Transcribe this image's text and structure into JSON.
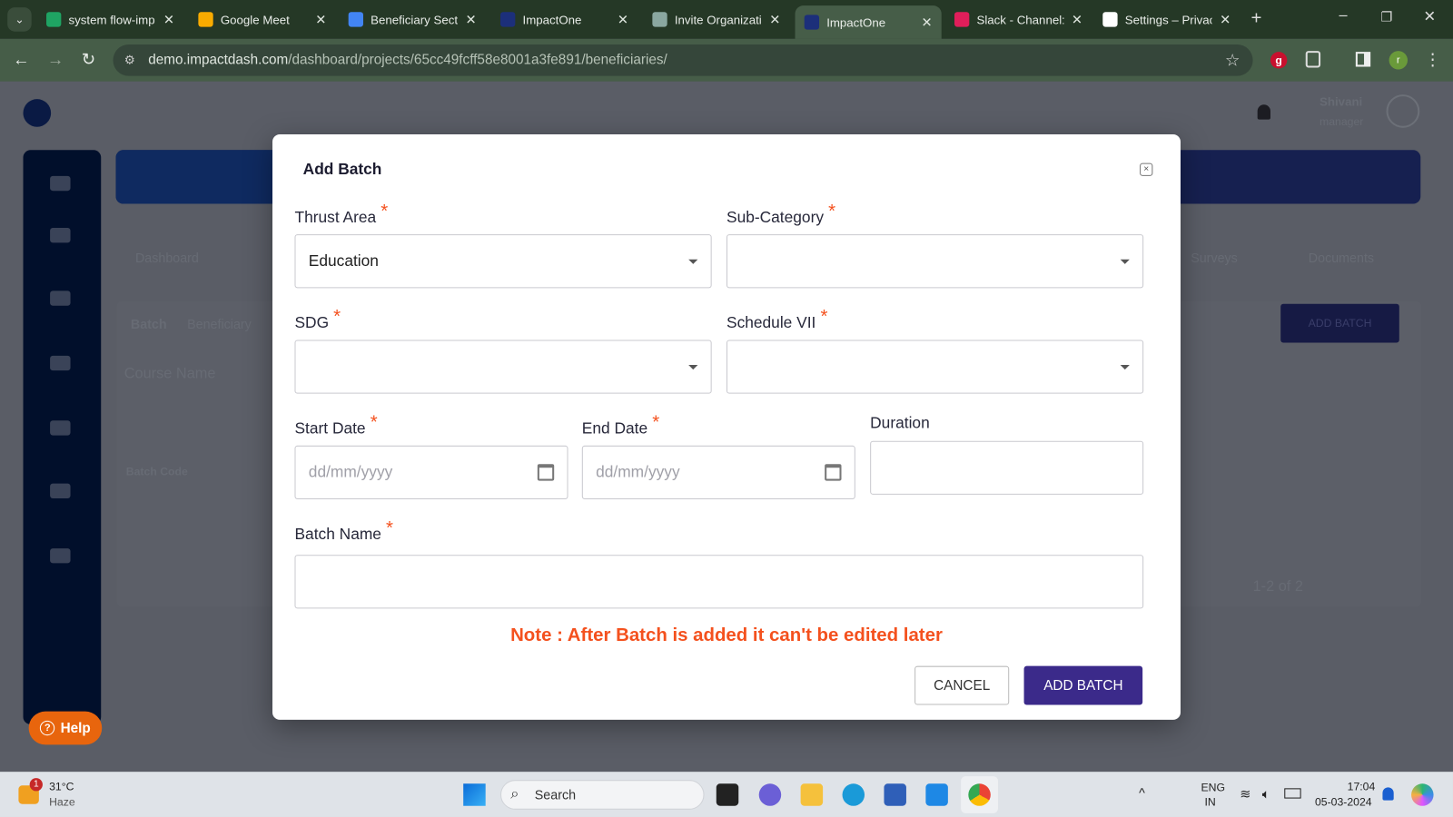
{
  "browser": {
    "tabs": [
      {
        "title": "system flow-imp",
        "color": "#1fa463"
      },
      {
        "title": "Google Meet",
        "color": "#f9ab00"
      },
      {
        "title": "Beneficiary Sectio",
        "color": "#4285f4"
      },
      {
        "title": "ImpactOne",
        "color": "#1c2f7a"
      },
      {
        "title": "Invite Organizatio",
        "color": "#8aa7a0"
      },
      {
        "title": "ImpactOne",
        "color": "#1c2f7a",
        "active": true
      },
      {
        "title": "Slack - Channel:",
        "color": "#e01e5a"
      },
      {
        "title": "Settings – Privacy",
        "color": "#ffffff"
      }
    ],
    "url_host": "demo.impactdash.com",
    "url_path": "/dashboard/projects/65cc49fcff58e8001a3fe891/beneficiaries/",
    "profile_initial": "r"
  },
  "background": {
    "help_label": "Help",
    "tabs_visible": [
      "Dashboard",
      "Surveys",
      "Documents"
    ],
    "sub_tabs": [
      "Batch",
      "Beneficiary"
    ],
    "course_label": "Course Name",
    "add_batch_label": "ADD BATCH",
    "column": "Batch Code",
    "pagination": "1-2 of 2",
    "user_name": "Shivani",
    "user_role": "manager"
  },
  "modal": {
    "title": "Add Batch",
    "thrust_area": {
      "label": "Thrust Area",
      "value": "Education"
    },
    "sub_category": {
      "label": "Sub-Category",
      "value": ""
    },
    "sdg": {
      "label": "SDG",
      "value": ""
    },
    "schedule_vii": {
      "label": "Schedule VII",
      "value": ""
    },
    "start_date": {
      "label": "Start Date",
      "placeholder": "dd/mm/yyyy"
    },
    "end_date": {
      "label": "End Date",
      "placeholder": "dd/mm/yyyy"
    },
    "duration": {
      "label": "Duration",
      "value": ""
    },
    "batch_name": {
      "label": "Batch Name",
      "value": ""
    },
    "required_mark": "*",
    "note": "Note : After Batch is added it can't be edited later",
    "cancel_label": "CANCEL",
    "submit_label": "ADD BATCH",
    "accent": "#3b2a8a",
    "note_color": "#f4511e"
  },
  "taskbar": {
    "weather_temp": "31°C",
    "weather_desc": "Haze",
    "weather_badge": "1",
    "search_placeholder": "Search",
    "lang": "ENG",
    "region": "IN",
    "time": "17:04",
    "date": "05-03-2024"
  }
}
